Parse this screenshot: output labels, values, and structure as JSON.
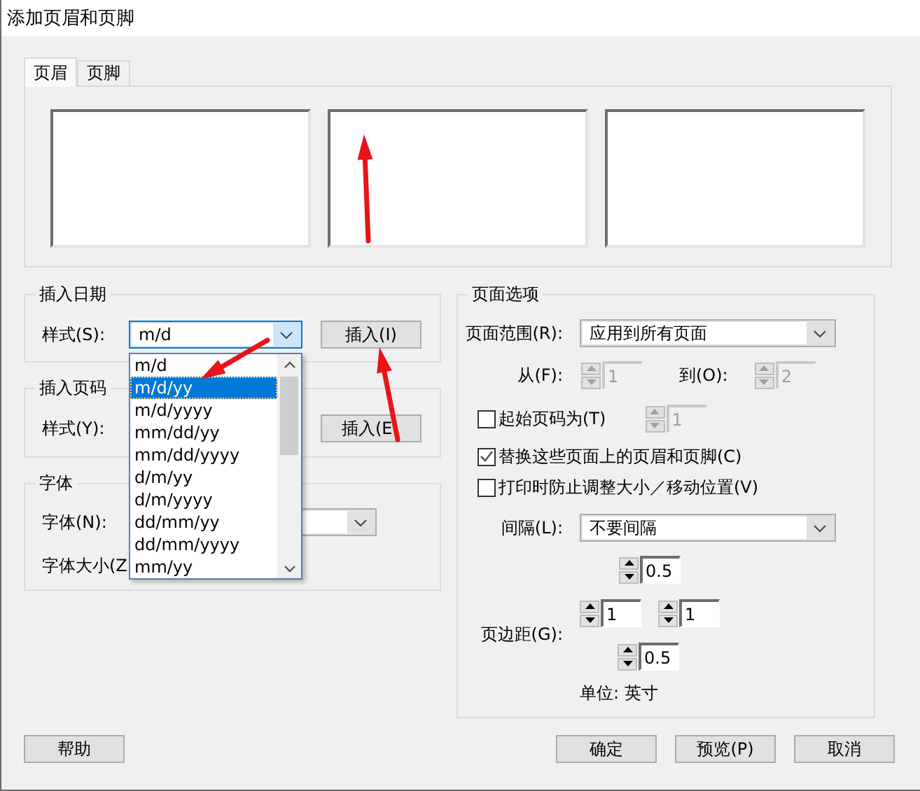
{
  "window": {
    "title": "添加页眉和页脚"
  },
  "tabs": [
    {
      "label": "页眉",
      "selected": true
    },
    {
      "label": "页脚",
      "selected": false
    }
  ],
  "insert_date": {
    "title": "插入日期",
    "style_label": "样式(S):",
    "style_value": "m/d",
    "button": "插入(I)",
    "options": [
      {
        "label": "m/d",
        "selected": false
      },
      {
        "label": "m/d/yy",
        "selected": true
      },
      {
        "label": "m/d/yyyy",
        "selected": false
      },
      {
        "label": "mm/dd/yy",
        "selected": false
      },
      {
        "label": "mm/dd/yyyy",
        "selected": false
      },
      {
        "label": "d/m/yy",
        "selected": false
      },
      {
        "label": "d/m/yyyy",
        "selected": false
      },
      {
        "label": "dd/mm/yy",
        "selected": false
      },
      {
        "label": "dd/mm/yyyy",
        "selected": false
      },
      {
        "label": "mm/yy",
        "selected": false
      }
    ]
  },
  "insert_page_number": {
    "title": "插入页码",
    "style_label": "样式(Y):",
    "button": "插入(E"
  },
  "font": {
    "title": "字体",
    "font_label": "字体(N):",
    "size_label": "字体大小(Z"
  },
  "page_options": {
    "title": "页面选项",
    "range_label": "页面范围(R):",
    "range_value": "应用到所有页面",
    "from": {
      "label": "从(F):",
      "value": "1",
      "disabled": true
    },
    "to": {
      "label": "到(O):",
      "value": "2",
      "disabled": true
    },
    "start_page": {
      "label": "起始页码为(T)",
      "checked": false,
      "value": "1",
      "disabled": true
    },
    "replace": {
      "label": "替换这些页面上的页眉和页脚(C)",
      "checked": true
    },
    "prevent_resize": {
      "label": "打印时防止调整大小／移动位置(V)",
      "checked": false
    },
    "spacing_label": "间隔(L):",
    "spacing_value": "不要间隔",
    "spacing_top": {
      "value": "0.5",
      "disabled": false
    },
    "margin_label": "页边距(G):",
    "margin_left": {
      "value": "1",
      "disabled": false
    },
    "margin_right": {
      "value": "1",
      "disabled": false
    },
    "margin_bottom": {
      "value": "0.5",
      "disabled": false
    },
    "unit": "单位: 英寸"
  },
  "buttons": {
    "help": "帮助",
    "ok": "确定",
    "preview": "预览(P)",
    "cancel": "取消"
  }
}
